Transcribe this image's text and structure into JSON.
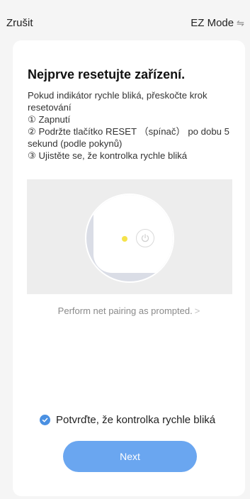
{
  "header": {
    "cancel_label": "Zrušit",
    "mode_label": "EZ Mode",
    "mode_icon": "swap-icon"
  },
  "card": {
    "title": "Nejprve resetujte zařízení.",
    "lines": [
      "Pokud indikátor rychle bliká, přeskočte krok resetování",
      "① Zapnutí",
      "② Podržte tlačítko RESET （spínač） po dobu 5 sekund (podle pokynů)",
      "③ Ujistěte se, že kontrolka rychle bliká"
    ],
    "pairing_link": "Perform net pairing as prompted.",
    "pairing_chevron": ">",
    "confirm_label": "Potvrďte, že kontrolka rychle bliká",
    "next_label": "Next"
  },
  "colors": {
    "accent": "#4a90e2",
    "button": "#6aa6f0",
    "led": "#f5e34b"
  }
}
